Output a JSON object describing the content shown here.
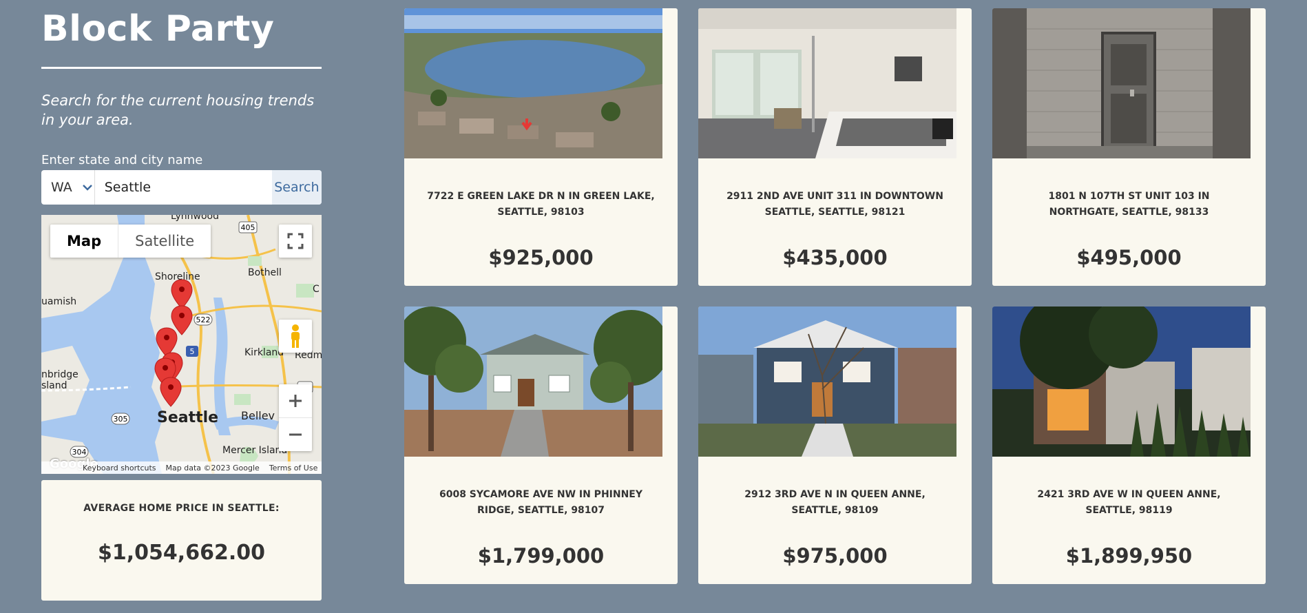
{
  "app": {
    "title": "Block Party"
  },
  "sidebar": {
    "tagline": "Search for the current housing trends in your area.",
    "field_label": "Enter state and city name"
  },
  "search": {
    "state_value": "WA",
    "city_value": "Seattle",
    "button_label": "Search"
  },
  "map": {
    "tabs": [
      {
        "label": "Map",
        "active": true
      },
      {
        "label": "Satellite",
        "active": false
      }
    ],
    "labels": {
      "lynnwood": "Lynnwood",
      "shoreline": "Shoreline",
      "bothell": "Bothell",
      "suquamish": "uamish",
      "kirkland": "Kirkland",
      "redmond": "Redm",
      "bainbridge": "nbridge\nsland",
      "seattle": "Seattle",
      "bellevue": "Bellev",
      "mercer": "Mercer Island",
      "edge_c": "C"
    },
    "route_badges": {
      "i405": "405",
      "r522": "522",
      "i5": "5",
      "r305": "305",
      "r304": "304",
      "i90": "90"
    },
    "footer": {
      "shortcuts": "Keyboard shortcuts",
      "data": "Map data ©2023 Google",
      "terms": "Terms of Use"
    },
    "logo": "Google"
  },
  "average": {
    "label": "AVERAGE HOME PRICE IN SEATTLE:",
    "value": "$1,054,662.00"
  },
  "listings": [
    {
      "address": "7722 E GREEN LAKE DR N IN GREEN LAKE, SEATTLE, 98103",
      "price": "$925,000"
    },
    {
      "address": "2911 2ND AVE UNIT 311 IN DOWNTOWN SEATTLE, SEATTLE, 98121",
      "price": "$435,000"
    },
    {
      "address": "1801 N 107TH ST UNIT 103 IN NORTHGATE, SEATTLE, 98133",
      "price": "$495,000"
    },
    {
      "address": "6008 SYCAMORE AVE NW IN PHINNEY RIDGE, SEATTLE, 98107",
      "price": "$1,799,000"
    },
    {
      "address": "2912 3RD AVE N IN QUEEN ANNE, SEATTLE, 98109",
      "price": "$975,000"
    },
    {
      "address": "2421 3RD AVE W IN QUEEN ANNE, SEATTLE, 98119",
      "price": "$1,899,950"
    }
  ],
  "colors": {
    "page_bg": "#778899",
    "card_bg": "#faf8ef",
    "button_text": "#3d6a9e",
    "marker": "#e53935"
  }
}
